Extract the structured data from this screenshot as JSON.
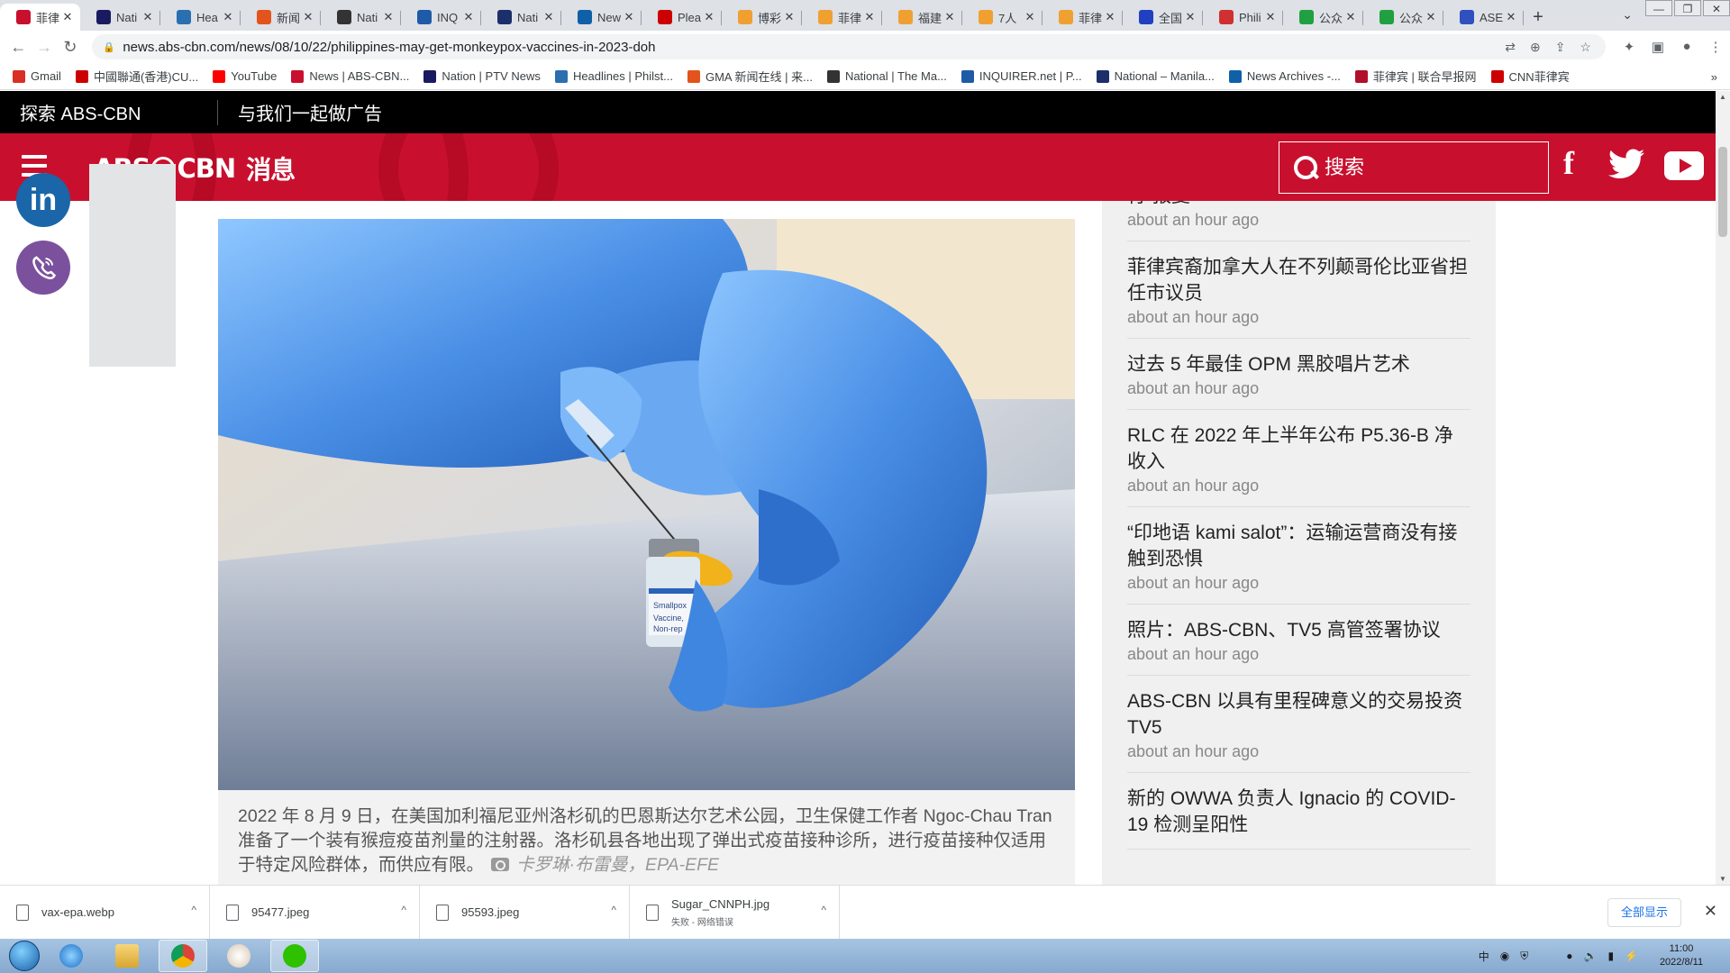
{
  "browser": {
    "tabs": [
      {
        "title": "菲律",
        "color": "#c8102e",
        "active": true
      },
      {
        "title": "Nati",
        "color": "#1a1a60"
      },
      {
        "title": "Hea",
        "color": "#2a6fb0"
      },
      {
        "title": "新闻",
        "color": "#e2541b"
      },
      {
        "title": "Nati",
        "color": "#333333"
      },
      {
        "title": "INQ",
        "color": "#1f5aa8"
      },
      {
        "title": "Nati",
        "color": "#1c2f6b"
      },
      {
        "title": "New",
        "color": "#1060a8"
      },
      {
        "title": "Plea",
        "color": "#cc0000"
      },
      {
        "title": "博彩",
        "color": "#f0a030"
      },
      {
        "title": "菲律",
        "color": "#f0a030"
      },
      {
        "title": "福建",
        "color": "#f0a030"
      },
      {
        "title": "7人",
        "color": "#f0a030"
      },
      {
        "title": "菲律",
        "color": "#f0a030"
      },
      {
        "title": "全国",
        "color": "#2040c0"
      },
      {
        "title": "Phili",
        "color": "#d03030"
      },
      {
        "title": "公众",
        "color": "#20a040"
      },
      {
        "title": "公众",
        "color": "#20a040"
      },
      {
        "title": "ASE",
        "color": "#3050c0"
      }
    ],
    "url": "news.abs-cbn.com/news/08/10/22/philippines-may-get-monkeypox-vaccines-in-2023-doh",
    "bookmarks": [
      {
        "label": "Gmail",
        "color": "#d93025"
      },
      {
        "label": "中國聯通(香港)CU...",
        "color": "#cc0000"
      },
      {
        "label": "YouTube",
        "color": "#ff0000"
      },
      {
        "label": "News | ABS-CBN...",
        "color": "#c8102e"
      },
      {
        "label": "Nation | PTV News",
        "color": "#1a1a60"
      },
      {
        "label": "Headlines | Philst...",
        "color": "#2a6fb0"
      },
      {
        "label": "GMA 新闻在线 | 来...",
        "color": "#e2541b"
      },
      {
        "label": "National | The Ma...",
        "color": "#333333"
      },
      {
        "label": "INQUIRER.net | P...",
        "color": "#1f5aa8"
      },
      {
        "label": "National – Manila...",
        "color": "#1c2f6b"
      },
      {
        "label": "News Archives -...",
        "color": "#1060a8"
      },
      {
        "label": "菲律宾 | 联合早报网",
        "color": "#b0102a"
      },
      {
        "label": "CNN菲律宾",
        "color": "#cc0000"
      }
    ],
    "bookmarks_more": "»"
  },
  "site": {
    "explore": "探索 ABS-CBN",
    "advertise": "与我们一起做广告",
    "logo_text": "ABS",
    "logo_text2": "CBN",
    "logo_news": "消息",
    "search_placeholder": "搜索",
    "colors": {
      "brand_red": "#c8102e",
      "linkedin": "#1a66a8",
      "viber": "#7b519d"
    }
  },
  "article": {
    "caption": "2022 年 8 月 9 日，在美国加利福尼亚州洛杉矶的巴恩斯达尔艺术公园，卫生保健工作者 Ngoc-Chau Tran 准备了一个装有猴痘疫苗剂量的注射器。洛杉矶县各地出现了弹出式疫苗接种诊所，进行疫苗接种仅适用于特定风险群体，而供应有限。",
    "credit": "卡罗琳·布雷曼，EPA-EFE",
    "vial_label": "Smallpox and Monkeypox Vaccine, Live, Non-replicating"
  },
  "sidebar": {
    "stories": [
      {
        "title": "行“报复”",
        "time": "about an hour ago"
      },
      {
        "title": "菲律宾裔加拿大人在不列颠哥伦比亚省担任市议员",
        "time": "about an hour ago"
      },
      {
        "title": "过去 5 年最佳 OPM 黑胶唱片艺术",
        "time": "about an hour ago"
      },
      {
        "title": "RLC 在 2022 年上半年公布 P5.36-B 净收入",
        "time": "about an hour ago"
      },
      {
        "title": "“印地语 kami salot”：运输运营商没有接触到恐惧",
        "time": "about an hour ago"
      },
      {
        "title": "照片：ABS-CBN、TV5 高管签署协议",
        "time": "about an hour ago"
      },
      {
        "title": "ABS-CBN 以具有里程碑意义的交易投资 TV5",
        "time": "about an hour ago"
      },
      {
        "title": "新的 OWWA 负责人 Ignacio 的 COVID-19 检测呈阳性",
        "time": ""
      }
    ]
  },
  "downloads": {
    "items": [
      {
        "name": "vax-epa.webp",
        "status": ""
      },
      {
        "name": "95477.jpeg",
        "status": ""
      },
      {
        "name": "95593.jpeg",
        "status": ""
      },
      {
        "name": "Sugar_CNNPH.jpg",
        "status": "失败 - 网络错误"
      }
    ],
    "show_all": "全部显示"
  },
  "taskbar": {
    "ime": "中",
    "time": "11:00",
    "date": "2022/8/11"
  }
}
